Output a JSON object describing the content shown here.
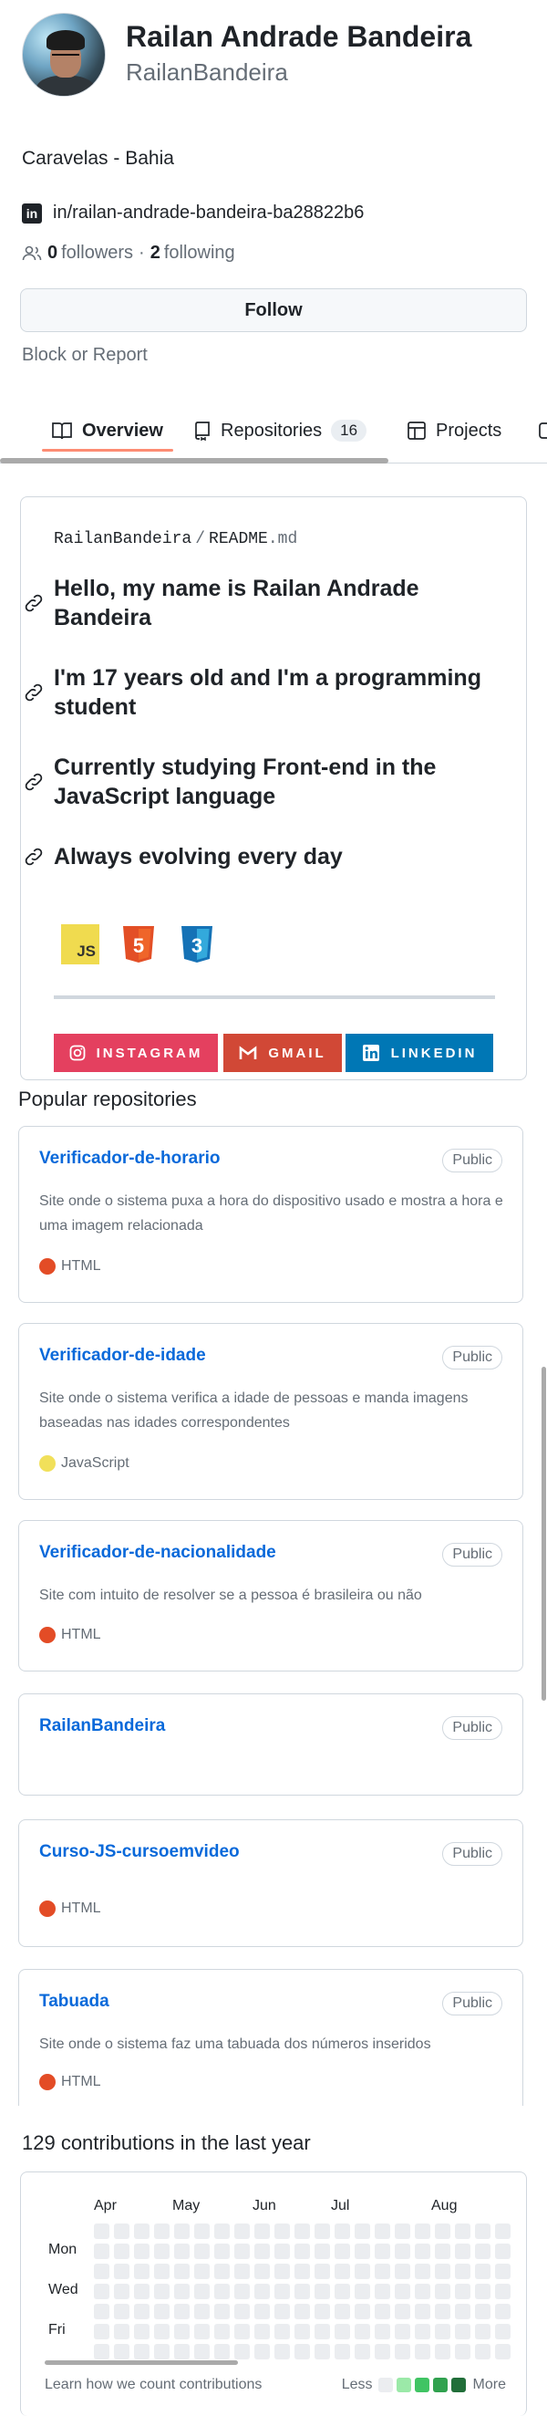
{
  "profile": {
    "name": "Railan Andrade Bandeira",
    "login": "RailanBandeira",
    "location": "Caravelas - Bahia",
    "linkedin": "in/railan-andrade-bandeira-ba28822b6",
    "followers_count": "0",
    "followers_label": "followers",
    "separator": "·",
    "following_count": "2",
    "following_label": "following",
    "follow_button": "Follow",
    "block_report": "Block or Report"
  },
  "tabs": [
    {
      "label": "Overview",
      "active": true
    },
    {
      "label": "Repositories",
      "count": "16"
    },
    {
      "label": "Projects"
    }
  ],
  "readme": {
    "owner": "RailanBandeira",
    "slash": "/",
    "file": "README",
    "ext": ".md",
    "headings": [
      "Hello, my name is Railan Andrade Bandeira",
      "I'm 17 years old and I'm a programming student",
      "Currently studying Front-end in the JavaScript language",
      "Always evolving every day"
    ],
    "badges": [
      {
        "label": "JS",
        "icon": "javascript-icon",
        "color": "#f0db4f"
      },
      {
        "label": "5",
        "icon": "html5-icon",
        "color": "#e34f26"
      },
      {
        "label": "3",
        "icon": "css3-icon",
        "color": "#1572b6"
      }
    ],
    "social_buttons": [
      {
        "label": "INSTAGRAM",
        "icon": "instagram-icon",
        "color": "#e4405f"
      },
      {
        "label": "GMAIL",
        "icon": "gmail-icon",
        "color": "#d14836"
      },
      {
        "label": "LINKEDIN",
        "icon": "linkedin-icon",
        "color": "#0077b5"
      }
    ]
  },
  "popular": {
    "title": "Popular repositories",
    "repos": [
      {
        "name": "Verificador-de-horario",
        "visibility": "Public",
        "description": "Site onde o sistema puxa a hora do dispositivo usado e mostra a hora e uma imagem relacionada",
        "language": "HTML",
        "language_color": "#e34c26"
      },
      {
        "name": "Verificador-de-idade",
        "visibility": "Public",
        "description": "Site onde o sistema verifica a idade de pessoas e manda imagens baseadas nas idades correspondentes",
        "language": "JavaScript",
        "language_color": "#f1e05a"
      },
      {
        "name": "Verificador-de-nacionalidade",
        "visibility": "Public",
        "description": "Site com intuito de resolver se a pessoa é brasileira ou não",
        "language": "HTML",
        "language_color": "#e34c26"
      },
      {
        "name": "RailanBandeira",
        "visibility": "Public",
        "description": "",
        "language": "",
        "language_color": ""
      },
      {
        "name": "Curso-JS-cursoemvideo",
        "visibility": "Public",
        "description": "",
        "language": "HTML",
        "language_color": "#e34c26"
      },
      {
        "name": "Tabuada",
        "visibility": "Public",
        "description": "Site onde o sistema faz uma tabuada dos números inseridos",
        "language": "HTML",
        "language_color": "#e34c26"
      }
    ]
  },
  "contributions": {
    "title": "129 contributions in the last year",
    "months": [
      "Apr",
      "May",
      "Jun",
      "Jul",
      "Aug"
    ],
    "days": [
      "Mon",
      "Wed",
      "Fri"
    ],
    "learn": "Learn how we count contributions",
    "less": "Less",
    "more": "More",
    "legend_colors": [
      "#ebedf0",
      "#9be9a8",
      "#40c463",
      "#30a14e",
      "#216e39"
    ]
  }
}
